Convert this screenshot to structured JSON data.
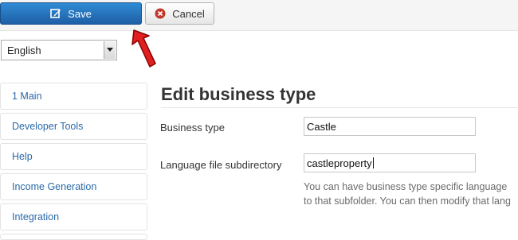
{
  "toolbar": {
    "save_label": "Save",
    "cancel_label": "Cancel"
  },
  "language_select": {
    "selected": "English"
  },
  "sidebar": {
    "items": [
      {
        "label": "1 Main"
      },
      {
        "label": "Developer Tools"
      },
      {
        "label": "Help"
      },
      {
        "label": "Income Generation"
      },
      {
        "label": "Integration"
      }
    ]
  },
  "main": {
    "title": "Edit business type",
    "fields": {
      "business_type": {
        "label": "Business type",
        "value": "Castle"
      },
      "language_dir": {
        "label": "Language file subdirectory",
        "value": "castleproperty"
      }
    },
    "help_lines": [
      "You can have business type specific language",
      "to that subfolder. You can then modify that lang"
    ]
  },
  "colors": {
    "primary": "#1f5fa6",
    "link": "#2a69a8",
    "cancel_icon": "#c0392b",
    "annotation_arrow": "#e02020"
  }
}
